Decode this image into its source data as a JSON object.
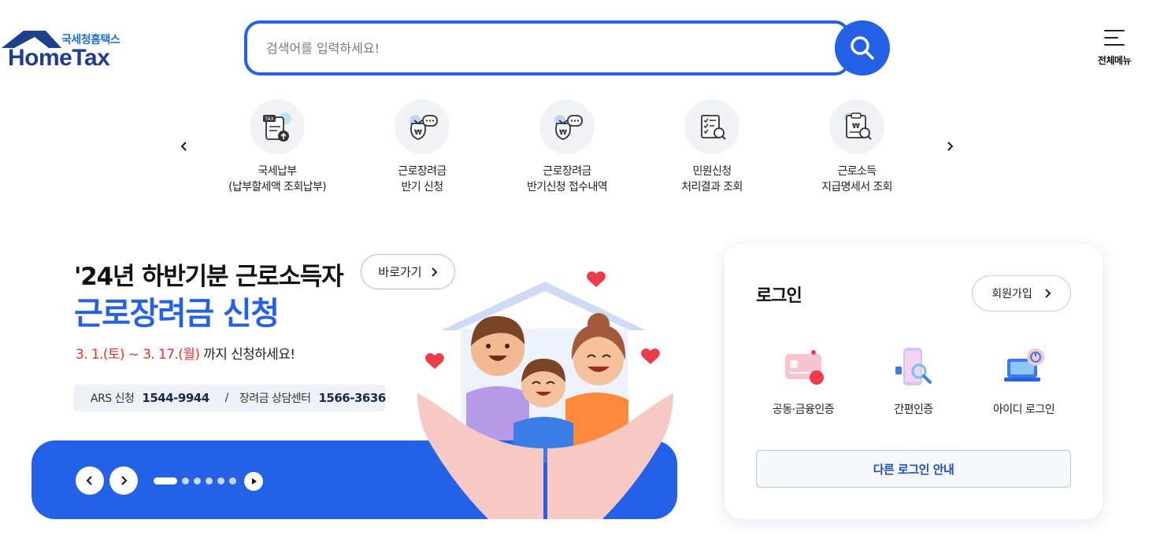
{
  "header": {
    "logo_sub": "국세청홈택스",
    "logo_main": "HomeTax",
    "search_placeholder": "검색어를 입력하세요!",
    "menu_label": "전체메뉴"
  },
  "quick_menu": [
    {
      "line1": "국세납부",
      "line2": "(납부할세액 조회납부)",
      "icon": "tax-payment-icon"
    },
    {
      "line1": "근로장려금",
      "line2": "반기 신청",
      "icon": "money-bag-chat-icon"
    },
    {
      "line1": "근로장려금",
      "line2": "반기신청 접수내역",
      "icon": "money-bag-chat-icon"
    },
    {
      "line1": "민원신청",
      "line2": "처리결과 조회",
      "icon": "checklist-search-icon"
    },
    {
      "line1": "근로소득",
      "line2": "지급명세서 조회",
      "icon": "document-search-icon"
    }
  ],
  "banner": {
    "line1": "'24년 하반기분 근로소득자",
    "go_label": "바로가기",
    "line2": "근로장려금 신청",
    "date_red": "3. 1.(토) ~ 3. 17.(월)",
    "date_rest": " 까지 신청하세요!",
    "ars_label": "ARS 신청",
    "ars_number": "1544-9944",
    "separator": "/",
    "center_label": "장려금 상담센터",
    "center_number": "1566-3636"
  },
  "login": {
    "title": "로그인",
    "join_label": "회원가입",
    "options": [
      {
        "label": "공동·금융인증",
        "icon": "certificate-card-icon"
      },
      {
        "label": "간편인증",
        "icon": "phone-search-icon"
      },
      {
        "label": "아이디 로그인",
        "icon": "laptop-power-icon"
      }
    ],
    "other_label": "다른 로그인 안내"
  },
  "colors": {
    "brand_blue": "#2461e6",
    "logo_navy": "#1d3f8f",
    "accent_red": "#e5322d"
  }
}
